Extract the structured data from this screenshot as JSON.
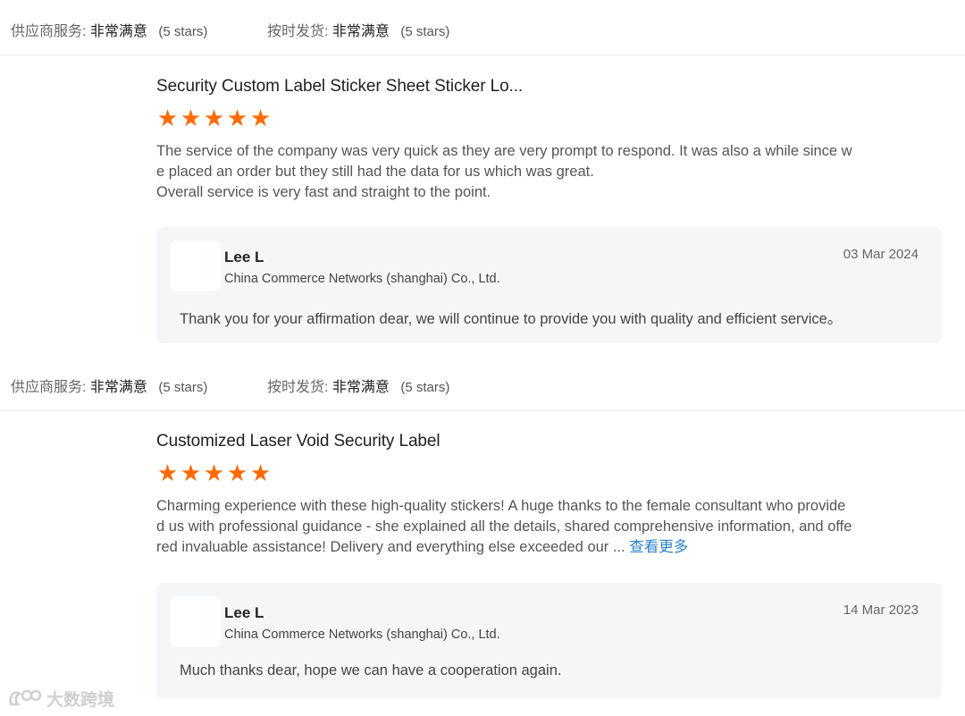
{
  "reviews": [
    {
      "ratings": {
        "service_label": "供应商服务:",
        "service_value": "非常满意",
        "service_stars": "(5 stars)",
        "shipping_label": "按时发货:",
        "shipping_value": "非常满意",
        "shipping_stars": "(5 stars)"
      },
      "title": "Security Custom Label Sticker Sheet Sticker Lo...",
      "stars": 5,
      "text_lines": [
        "The service of the company was very quick as they are very prompt to respond. It was also a while since w",
        "e placed an order but they still had the data for us which was great.",
        "Overall service is very fast and straight to the point."
      ],
      "view_more": "",
      "reply": {
        "name": "Lee L",
        "company": "China Commerce Networks (shanghai) Co., Ltd.",
        "date": "03 Mar 2024",
        "text": "Thank you for your affirmation dear, we will continue to provide you with quality and efficient service。"
      }
    },
    {
      "ratings": {
        "service_label": "供应商服务:",
        "service_value": "非常满意",
        "service_stars": "(5 stars)",
        "shipping_label": "按时发货:",
        "shipping_value": "非常满意",
        "shipping_stars": "(5 stars)"
      },
      "title": "Customized Laser Void Security Label",
      "stars": 5,
      "text_lines": [
        "Charming experience with these high-quality stickers! A huge thanks to the female consultant who provide",
        "d us with professional guidance - she explained all the details, shared comprehensive information, and offe",
        "red invaluable assistance! Delivery and everything else exceeded our ... "
      ],
      "view_more": "查看更多",
      "reply": {
        "name": "Lee L",
        "company": "China Commerce Networks (shanghai) Co., Ltd.",
        "date": "14 Mar 2023",
        "text": "Much thanks dear, hope we can have a cooperation again."
      }
    }
  ],
  "watermark": {
    "text": "大数跨境"
  },
  "colors": {
    "star": "#ff6a00",
    "link": "#2c82c9",
    "reply_bg": "#f5f6f8"
  },
  "icons": {
    "star": "star-icon",
    "watermark_logo": "brand-logo-icon"
  }
}
